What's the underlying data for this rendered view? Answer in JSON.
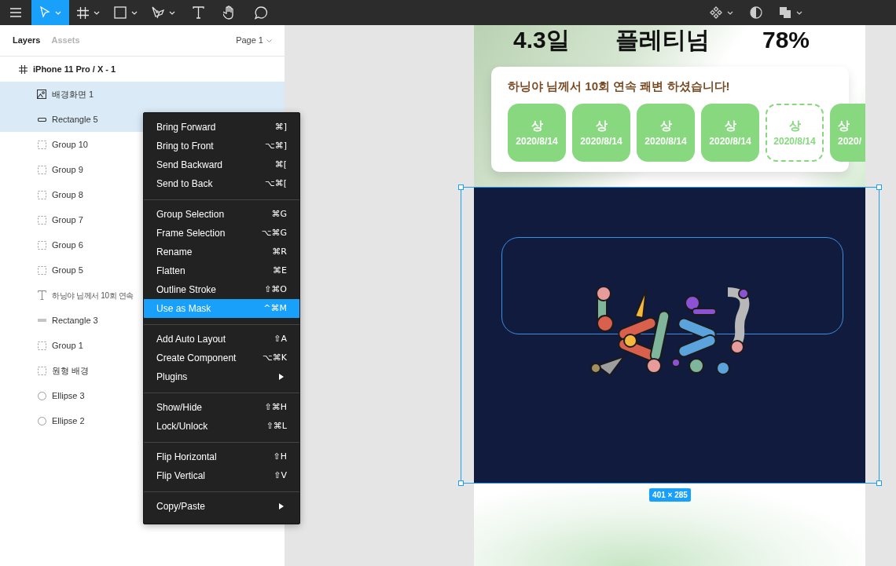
{
  "toolbar": {
    "tools": [
      {
        "kind": "menu",
        "selected": false,
        "dropdown": false
      },
      {
        "kind": "move",
        "selected": true,
        "dropdown": true
      },
      {
        "kind": "frame",
        "selected": false,
        "dropdown": true
      },
      {
        "kind": "shape",
        "selected": false,
        "dropdown": true
      },
      {
        "kind": "pen",
        "selected": false,
        "dropdown": true
      },
      {
        "kind": "text",
        "selected": false,
        "dropdown": false
      },
      {
        "kind": "hand",
        "selected": false,
        "dropdown": false
      },
      {
        "kind": "comment",
        "selected": false,
        "dropdown": false
      }
    ],
    "right_tools": [
      {
        "kind": "components",
        "dropdown": true
      },
      {
        "kind": "contrast",
        "dropdown": false
      },
      {
        "kind": "boolean",
        "dropdown": true
      }
    ]
  },
  "layers_panel": {
    "tabs": [
      {
        "label": "Layers",
        "selected": true
      },
      {
        "label": "Assets",
        "selected": false
      }
    ],
    "page": "Page 1",
    "layers": [
      {
        "name": "iPhone 11 Pro / X - 1",
        "kind": "frame",
        "selected": false,
        "children": [
          {
            "name": "배경화면 1",
            "kind": "image",
            "selected": true
          },
          {
            "name": "Rectangle 5",
            "kind": "rectangle",
            "selected": true
          },
          {
            "name": "Group 10",
            "kind": "group",
            "selected": false
          },
          {
            "name": "Group 9",
            "kind": "group",
            "selected": false
          },
          {
            "name": "Group 8",
            "kind": "group",
            "selected": false
          },
          {
            "name": "Group 7",
            "kind": "group",
            "selected": false
          },
          {
            "name": "Group 6",
            "kind": "group",
            "selected": false
          },
          {
            "name": "Group 5",
            "kind": "group",
            "selected": false
          },
          {
            "name": "하닝야 님께서 10회 연속",
            "kind": "text",
            "selected": false
          },
          {
            "name": "Rectangle 3",
            "kind": "bar",
            "selected": false
          },
          {
            "name": "Group 1",
            "kind": "group",
            "selected": false
          },
          {
            "name": "원형 배경",
            "kind": "group",
            "selected": false
          },
          {
            "name": "Ellipse 3",
            "kind": "ellipse",
            "selected": false
          },
          {
            "name": "Ellipse 2",
            "kind": "ellipse",
            "selected": false
          }
        ]
      }
    ]
  },
  "context_menu": {
    "groups": [
      [
        {
          "label": "Bring Forward",
          "shortcut": "⌘]",
          "highlighted": false,
          "submenu": false
        },
        {
          "label": "Bring to Front",
          "shortcut": "⌥⌘]",
          "highlighted": false,
          "submenu": false
        },
        {
          "label": "Send Backward",
          "shortcut": "⌘[",
          "highlighted": false,
          "submenu": false
        },
        {
          "label": "Send to Back",
          "shortcut": "⌥⌘[",
          "highlighted": false,
          "submenu": false
        }
      ],
      [
        {
          "label": "Group Selection",
          "shortcut": "⌘G",
          "highlighted": false,
          "submenu": false
        },
        {
          "label": "Frame Selection",
          "shortcut": "⌥⌘G",
          "highlighted": false,
          "submenu": false
        },
        {
          "label": "Rename",
          "shortcut": "⌘R",
          "highlighted": false,
          "submenu": false
        },
        {
          "label": "Flatten",
          "shortcut": "⌘E",
          "highlighted": false,
          "submenu": false
        },
        {
          "label": "Outline Stroke",
          "shortcut": "⇧⌘O",
          "highlighted": false,
          "submenu": false
        },
        {
          "label": "Use as Mask",
          "shortcut": "^⌘M",
          "highlighted": true,
          "submenu": false
        }
      ],
      [
        {
          "label": "Add Auto Layout",
          "shortcut": "⇧A",
          "highlighted": false,
          "submenu": false
        },
        {
          "label": "Create Component",
          "shortcut": "⌥⌘K",
          "highlighted": false,
          "submenu": false
        },
        {
          "label": "Plugins",
          "highlighted": false,
          "submenu": true
        }
      ],
      [
        {
          "label": "Show/Hide",
          "shortcut": "⇧⌘H",
          "highlighted": false,
          "submenu": false
        },
        {
          "label": "Lock/Unlock",
          "shortcut": "⇧⌘L",
          "highlighted": false,
          "submenu": false
        }
      ],
      [
        {
          "label": "Flip Horizontal",
          "shortcut": "⇧H",
          "highlighted": false,
          "submenu": false
        },
        {
          "label": "Flip Vertical",
          "shortcut": "⇧V",
          "highlighted": false,
          "submenu": false
        }
      ],
      [
        {
          "label": "Copy/Paste",
          "highlighted": false,
          "submenu": true
        }
      ]
    ]
  },
  "canvas": {
    "stats": [
      "4.3일",
      "플레티넘",
      "78%"
    ],
    "streak_card": {
      "title": "하닝야 님께서 10회 연속 쾌변 하셨습니다!",
      "badges": [
        {
          "grade": "상",
          "date": "2020/8/14",
          "kind": "filled"
        },
        {
          "grade": "상",
          "date": "2020/8/14",
          "kind": "filled"
        },
        {
          "grade": "상",
          "date": "2020/8/14",
          "kind": "filled"
        },
        {
          "grade": "상",
          "date": "2020/8/14",
          "kind": "filled"
        },
        {
          "grade": "상",
          "date": "2020/8/14",
          "kind": "dashed"
        },
        {
          "grade": "상",
          "date": "2020/",
          "kind": "cut"
        }
      ]
    },
    "selection": {
      "size": "401 × 285"
    }
  }
}
